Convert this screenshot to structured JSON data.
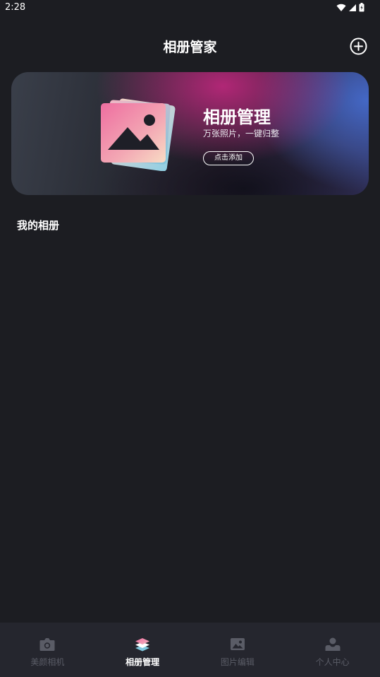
{
  "status_bar": {
    "time": "2:28"
  },
  "header": {
    "title": "相册管家",
    "add_icon": "plus-circle-icon"
  },
  "banner": {
    "title": "相册管理",
    "subtitle": "万张照片，一键归整",
    "button_label": "点击添加",
    "illustration": "photo-stack-icon",
    "colors": {
      "pink": "#e9729e",
      "blue": "#7fc6dd",
      "magenta": "#c82882",
      "indigo": "#466ed2"
    }
  },
  "section": {
    "title": "我的相册"
  },
  "bottom_nav": {
    "items": [
      {
        "label": "美颜相机",
        "icon": "camera-icon",
        "active": false
      },
      {
        "label": "相册管理",
        "icon": "layers-icon",
        "active": true
      },
      {
        "label": "图片编辑",
        "icon": "image-icon",
        "active": false
      },
      {
        "label": "个人中心",
        "icon": "user-icon",
        "active": false
      }
    ]
  },
  "colors": {
    "background": "#1c1d22",
    "nav_background": "#25262e",
    "inactive_nav": "#5a5c66",
    "text": "#ffffff"
  }
}
